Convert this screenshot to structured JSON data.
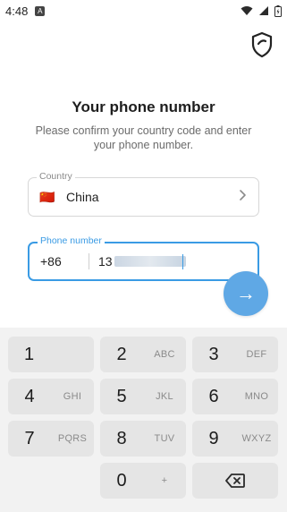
{
  "status_bar": {
    "time": "4:48",
    "app_icon": "A"
  },
  "header": {
    "title": "Your phone number",
    "subtitle": "Please confirm your country code and enter your phone number."
  },
  "country": {
    "label": "Country",
    "flag": "🇨🇳",
    "name": "China"
  },
  "phone": {
    "label": "Phone number",
    "code": "+86",
    "number_prefix": "13"
  },
  "next_button": {
    "icon": "→"
  },
  "keypad": {
    "keys": [
      {
        "digit": "1",
        "letters": ""
      },
      {
        "digit": "2",
        "letters": "ABC"
      },
      {
        "digit": "3",
        "letters": "DEF"
      },
      {
        "digit": "4",
        "letters": "GHI"
      },
      {
        "digit": "5",
        "letters": "JKL"
      },
      {
        "digit": "6",
        "letters": "MNO"
      },
      {
        "digit": "7",
        "letters": "PQRS"
      },
      {
        "digit": "8",
        "letters": "TUV"
      },
      {
        "digit": "9",
        "letters": "WXYZ"
      },
      {
        "digit": "0",
        "letters": "+"
      }
    ]
  }
}
